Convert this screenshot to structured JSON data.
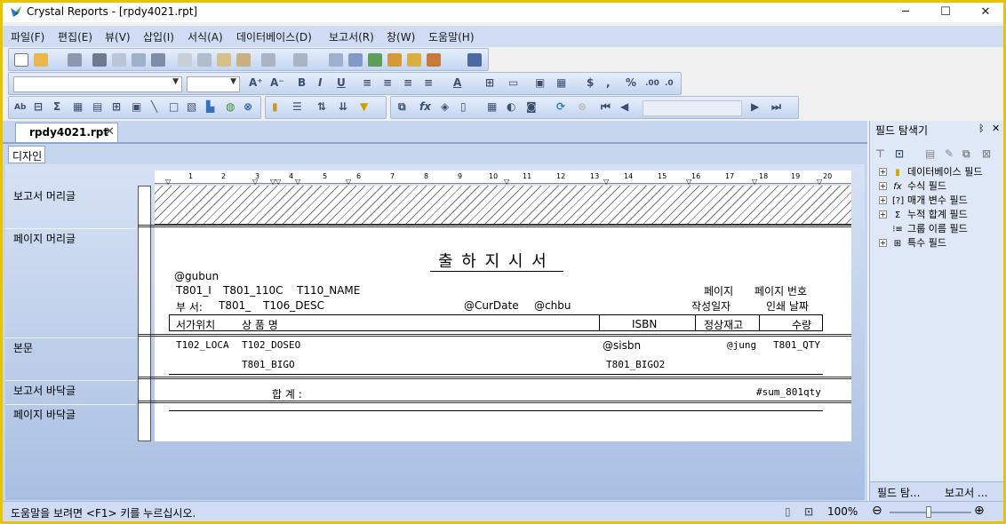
{
  "window": {
    "title": "Crystal Reports - [rpdy4021.rpt]",
    "minimize": "─",
    "maximize": "☐",
    "close": "✕"
  },
  "menu": [
    "파일(F)",
    "편집(E)",
    "뷰(V)",
    "삽입(I)",
    "서식(A)",
    "데이터베이스(D)",
    "보고서(R)",
    "창(W)",
    "도움말(H)"
  ],
  "document": {
    "tab_label": "rpdy4021.rpt",
    "tab_close": "✕",
    "design_tab": "디자인"
  },
  "sections": [
    "보고서 머리글",
    "페이지 머리글",
    "본문",
    "보고서 바닥글",
    "페이지 바닥글"
  ],
  "ruler_ticks": [
    "1",
    "2",
    "3",
    "4",
    "5",
    "6",
    "7",
    "8",
    "9",
    "10",
    "11",
    "12",
    "13",
    "14",
    "15",
    "16",
    "17",
    "18",
    "19",
    "20"
  ],
  "report": {
    "title": "출 하 지 시 서",
    "gubun": "@gubun",
    "row1": {
      "f1": "T801_I",
      "f2": "T801_110C",
      "f3": "T110_NAME",
      "page_label": "페이지",
      "page_no": "페이지 번호"
    },
    "row2": {
      "label": "부 서:",
      "f1": "T801_",
      "f2": "T106_DESC",
      "curdate": "@CurDate",
      "chbu": "@chbu",
      "date_label": "작성일자",
      "print_date": "인쇄 날짜"
    },
    "header": {
      "loc": "서가위치",
      "name": "상 품 명",
      "isbn": "ISBN",
      "stock": "정상재고",
      "qty": "수량"
    },
    "detail1": {
      "loca": "T102_LOCA",
      "doseo": "T102_DOSEO",
      "isbn": "@sisbn",
      "jung": "@jung",
      "qty": "T801_QTY"
    },
    "detail2": {
      "bigo": "T801_BIGO",
      "bigo2": "T801_BIGO2"
    },
    "footer": {
      "total_label": "합 계 :",
      "total": "#sum_801qty"
    }
  },
  "field_explorer": {
    "title": "필드 탐색기",
    "pin": "ᛒ",
    "close": "✕",
    "items": [
      {
        "label": "데이터베이스 필드",
        "icon": "database-icon"
      },
      {
        "label": "수식 필드",
        "icon": "formula-icon"
      },
      {
        "label": "매개 변수 필드",
        "icon": "parameter-icon"
      },
      {
        "label": "누적 합계 필드",
        "icon": "running-total-icon"
      },
      {
        "label": "그룹 이름 필드",
        "icon": "group-name-icon"
      },
      {
        "label": "특수 필드",
        "icon": "special-field-icon"
      }
    ],
    "bottom_tabs": [
      "필드 탐...",
      "보고서 ..."
    ]
  },
  "status": {
    "message": "도움말을 보려면 <F1> 키를 누르십시오.",
    "zoom": "100%"
  }
}
